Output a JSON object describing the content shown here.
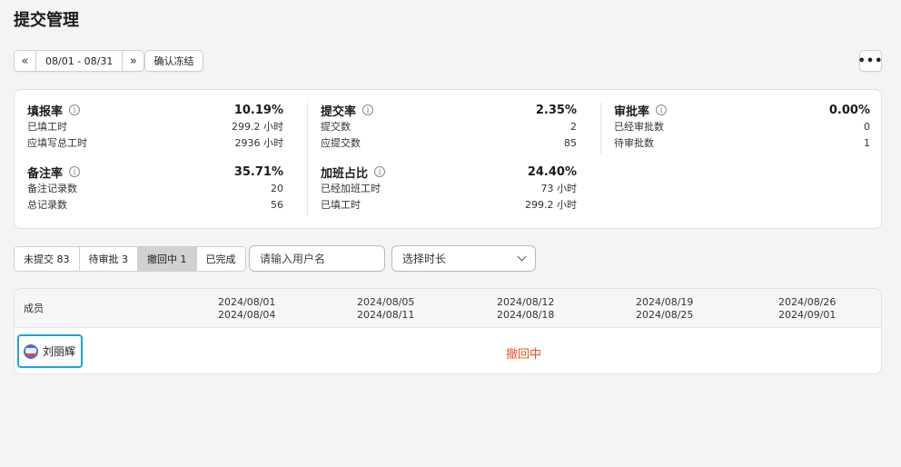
{
  "page": {
    "title": "提交管理"
  },
  "date_nav": {
    "prev_icon": "«",
    "next_icon": "»",
    "range": "08/01 - 08/31"
  },
  "toolbar": {
    "confirm_label": "确认冻结",
    "more_icon": "•••"
  },
  "stats": {
    "fill_rate": {
      "name": "填报率",
      "value": "10.19%",
      "rows": [
        {
          "label": "已填工时",
          "value": "299.2 小时"
        },
        {
          "label": "应填写总工时",
          "value": "2936 小时"
        }
      ]
    },
    "submit_rate": {
      "name": "提交率",
      "value": "2.35%",
      "rows": [
        {
          "label": "提交数",
          "value": "2"
        },
        {
          "label": "应提交数",
          "value": "85"
        }
      ]
    },
    "approve_rate": {
      "name": "审批率",
      "value": "0.00%",
      "rows": [
        {
          "label": "已经审批数",
          "value": "0"
        },
        {
          "label": "待审批数",
          "value": "1"
        }
      ]
    },
    "remark_rate": {
      "name": "备注率",
      "value": "35.71%",
      "rows": [
        {
          "label": "备注记录数",
          "value": "20"
        },
        {
          "label": "总记录数",
          "value": "56"
        }
      ]
    },
    "overtime_ratio": {
      "name": "加班占比",
      "value": "24.40%",
      "rows": [
        {
          "label": "已经加班工时",
          "value": "73 小时"
        },
        {
          "label": "已填工时",
          "value": "299.2 小时"
        }
      ]
    },
    "info_icon": "i"
  },
  "filters": {
    "tabs": [
      {
        "label": "未提交 83",
        "active": false
      },
      {
        "label": "待审批 3",
        "active": false
      },
      {
        "label": "撤回中 1",
        "active": true
      },
      {
        "label": "已完成",
        "active": false
      }
    ],
    "user_placeholder": "请输入用户名",
    "duration_placeholder": "选择时长"
  },
  "table": {
    "member_header": "成员",
    "weeks": [
      {
        "start": "2024/08/01",
        "end": "2024/08/04"
      },
      {
        "start": "2024/08/05",
        "end": "2024/08/11"
      },
      {
        "start": "2024/08/12",
        "end": "2024/08/18"
      },
      {
        "start": "2024/08/19",
        "end": "2024/08/25"
      },
      {
        "start": "2024/08/26",
        "end": "2024/09/01"
      }
    ],
    "rows": [
      {
        "name": "刘丽辉",
        "status": "撤回中"
      }
    ]
  },
  "colors": {
    "accent": "#1aa3e0",
    "status_withdrawing": "#e8541e",
    "tab_active_bg": "#d1d1d3"
  }
}
